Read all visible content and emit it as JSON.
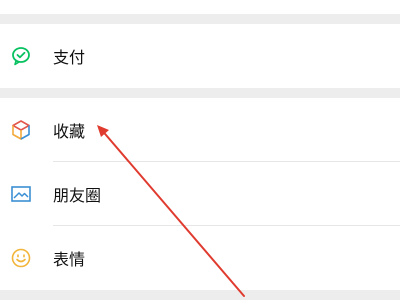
{
  "menu": {
    "items": [
      {
        "label": "支付",
        "icon": "wechat-pay-icon",
        "color": "#07c160"
      },
      {
        "label": "收藏",
        "icon": "favorites-cube-icon",
        "color": "#f3a93b"
      },
      {
        "label": "朋友圈",
        "icon": "moments-photo-icon",
        "color": "#3b8fd4"
      },
      {
        "label": "表情",
        "icon": "sticker-smile-icon",
        "color": "#f2b53a"
      }
    ]
  },
  "colors": {
    "background": "#ededed",
    "row_background": "#ffffff",
    "text": "#111111",
    "annotation_arrow": "#e03b2f"
  }
}
